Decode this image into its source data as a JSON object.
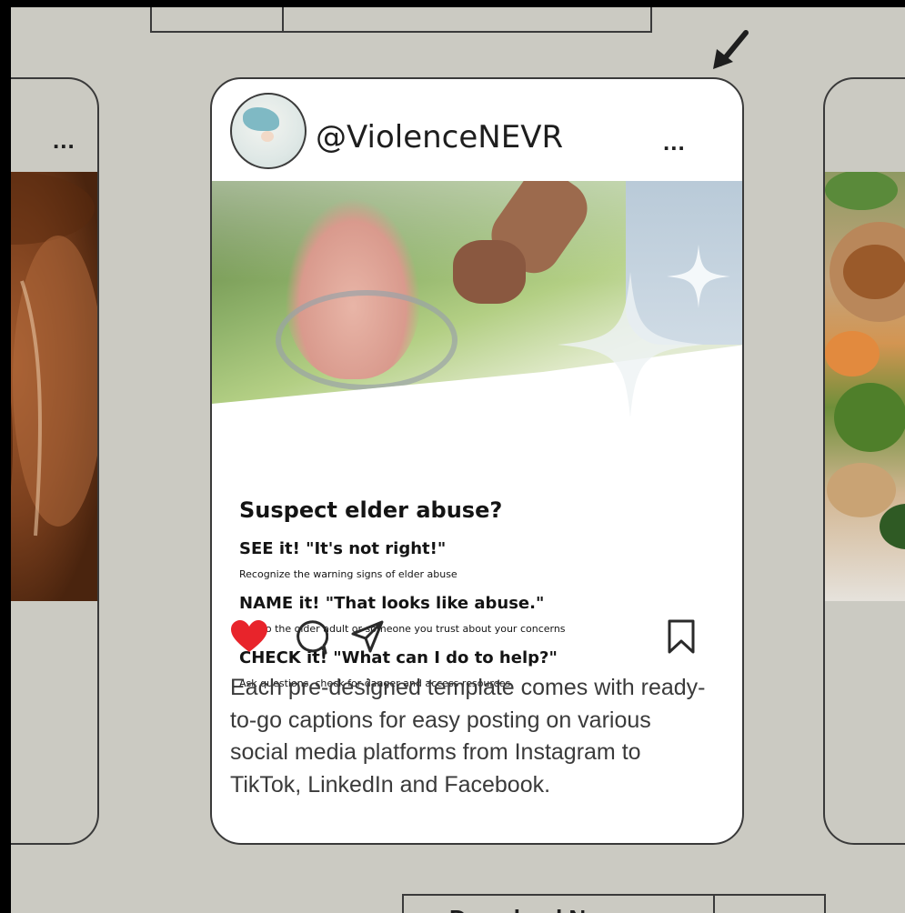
{
  "post": {
    "handle": "@ViolenceNEVR",
    "more": "...",
    "image_text": {
      "title": "Suspect elder abuse?",
      "see_heading": "SEE it! \"It's not right!\"",
      "see_sub": "Recognize the warning signs of elder abuse",
      "name_heading": "NAME it! \"That looks like abuse.\"",
      "name_sub": "Talk to the older adult or someone you trust about your concerns",
      "check_heading": "CHECK it! \"What can I do to help?\"",
      "check_sub": "Ask questions, check for danger and access resources"
    },
    "caption": "Each pre-designed template comes with ready-to-go captions for easy posting on various social media platforms from Instagram to TikTok, LinkedIn and Facebook.",
    "liked": true
  },
  "left_card": {
    "more": "..."
  },
  "download": {
    "label": "Download Now"
  },
  "colors": {
    "background": "#cbcac2",
    "card": "#ffffff",
    "heart": "#e8242b",
    "outline": "#3a3a3a"
  },
  "icons": [
    "arrow-icon",
    "heart-icon",
    "comment-icon",
    "share-icon",
    "bookmark-icon"
  ]
}
